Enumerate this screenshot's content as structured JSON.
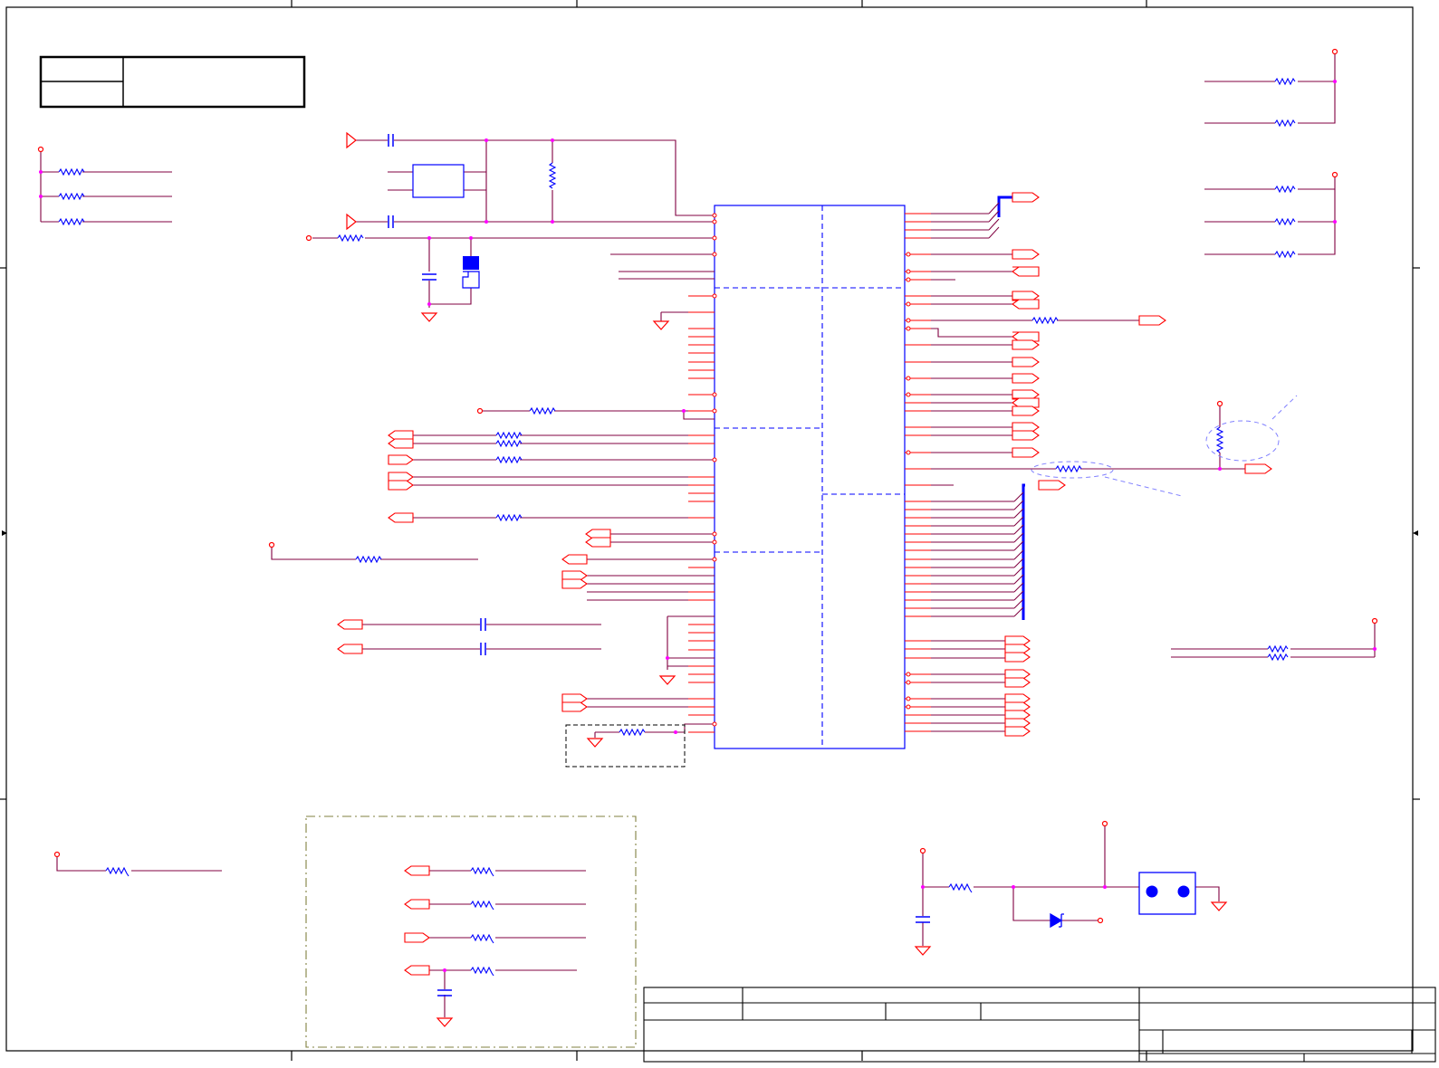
{
  "sheet": {
    "title": "",
    "colors": {
      "wire": "#800040",
      "net": "#ff0000",
      "component": "#0000ff",
      "frame": "#000000",
      "junction": "#ff00ff",
      "annotation": "#8080ff",
      "group_box": "#808040"
    }
  },
  "components": {
    "main_ic": "main-ic",
    "crystal": "crystal",
    "two_pin_connector": "two-pin-connector",
    "zener_diode": "zener-diode"
  },
  "title_block": {
    "fields": []
  }
}
